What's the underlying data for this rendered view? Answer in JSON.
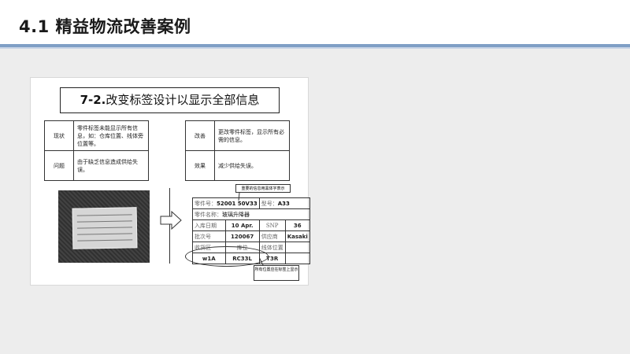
{
  "header": {
    "title": "4.1 精益物流改善案例"
  },
  "slide": {
    "title_num": "7-2.",
    "title_text": "改变标签设计以显示全部信息",
    "before": {
      "rows": [
        {
          "label": "现状",
          "text": "零件标签未能显示所有信息，如：仓库位置、线体旁位置等。"
        },
        {
          "label": "问题",
          "text": "由于缺乏信息造成供给失误。"
        }
      ]
    },
    "after": {
      "rows": [
        {
          "label": "改善",
          "text": "更改零件标签，显示所有必需的信息。"
        },
        {
          "label": "效果",
          "text": "减少供给失误。"
        }
      ]
    },
    "callout_top": "重要的信息用黑体字表示",
    "callout_bottom": "所有位置应在标签上显示",
    "label": {
      "part_no_label": "零件号：",
      "part_no_value": "52001 50V33",
      "model_label": "型号：",
      "model_value": "A33",
      "part_name_label": "零件名称：",
      "part_name_value": "玻璃升降器",
      "date_label": "入库日期",
      "date_value": "10 Apr.",
      "snp_label": "SNP",
      "snp_value": "36",
      "lot_label": "批次号",
      "lot_value": "120067",
      "supplier_label": "供应商",
      "supplier_value": "Kasaki",
      "area_label": "收货区",
      "location_label": "库位",
      "line_label": "线体位置",
      "area_value": "w1A",
      "location_value": "RC33L",
      "line_value": "T3R"
    }
  }
}
